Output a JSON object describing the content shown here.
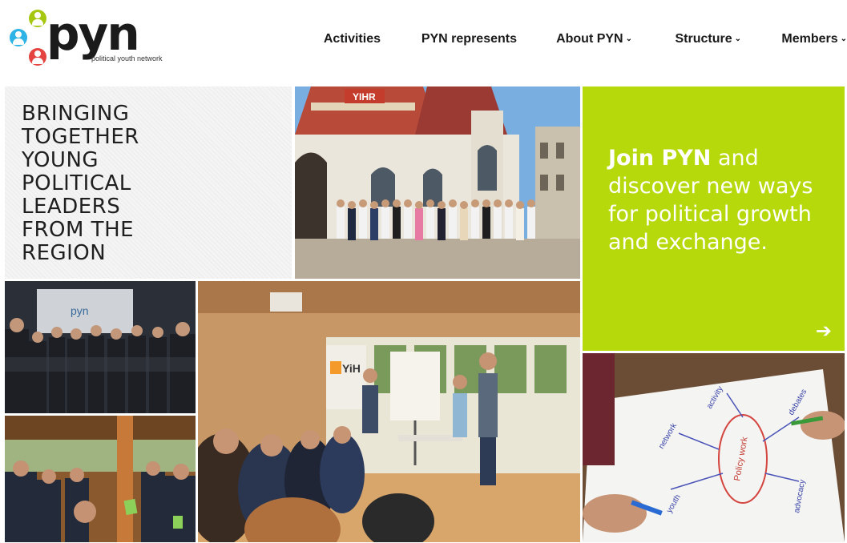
{
  "logo": {
    "word": "pyn",
    "tagline": "political youth network"
  },
  "nav": [
    {
      "label": "Activities",
      "dropdown": false
    },
    {
      "label": "PYN represents",
      "dropdown": false
    },
    {
      "label": "About PYN",
      "dropdown": true
    },
    {
      "label": "Structure",
      "dropdown": true
    },
    {
      "label": "Members",
      "dropdown": true
    }
  ],
  "hero": {
    "lines": [
      "BRINGING",
      "TOGETHER",
      "YOUNG",
      "POLITICAL",
      "LEADERS",
      "FROM THE",
      "REGION"
    ]
  },
  "join": {
    "bold": "Join PYN",
    "rest": " and discover new ways for political growth and exchange."
  },
  "photo_church": {
    "sign": "YIHR"
  },
  "photo_hall": {
    "screen": "pyn"
  },
  "photo_workshop": {
    "banner": "YiH"
  },
  "photo_draw": {
    "center": "Policy work",
    "words": [
      "activity",
      "network",
      "debates",
      "advocacy",
      "youth"
    ]
  },
  "colors": {
    "accent": "#b5d90a",
    "text": "#1f1f1f",
    "logo_green": "#a6c70f",
    "logo_blue": "#2db3e6",
    "logo_red": "#e4433f"
  },
  "icons": {
    "join_arrow": "arrow-right-icon",
    "dropdown": "chevron-down-icon"
  }
}
